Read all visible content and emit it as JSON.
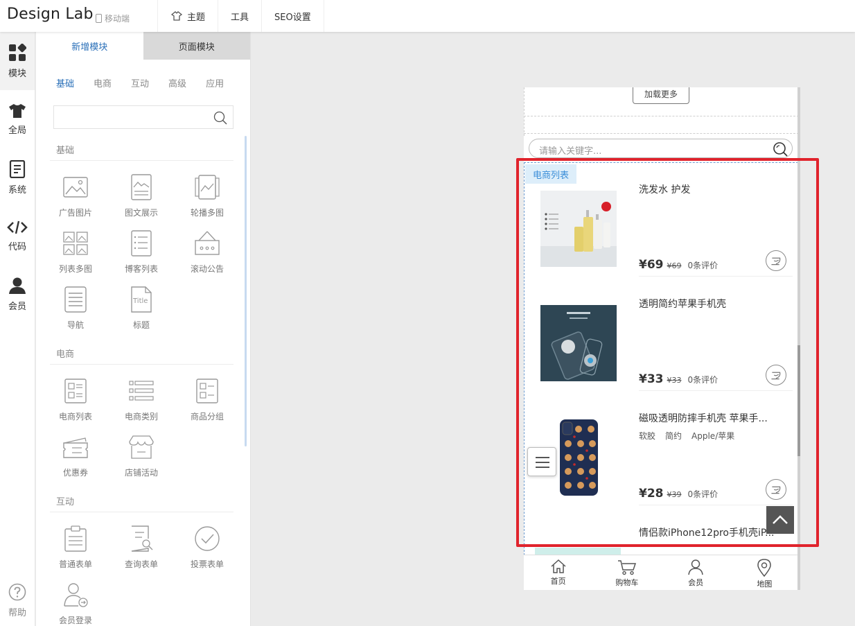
{
  "app": {
    "brand": "Design Lab",
    "device_label": "移动端"
  },
  "topnav": [
    {
      "label": "主题",
      "icon": "theme-icon"
    },
    {
      "label": "工具",
      "icon": ""
    },
    {
      "label": "SEO设置",
      "icon": ""
    }
  ],
  "rail": [
    {
      "label": "模块",
      "icon": "modules-icon",
      "active": true
    },
    {
      "label": "全局",
      "icon": "shirt-icon"
    },
    {
      "label": "系统",
      "icon": "document-icon"
    },
    {
      "label": "代码",
      "icon": "code-icon"
    },
    {
      "label": "会员",
      "icon": "user-icon"
    },
    {
      "label": "帮助",
      "icon": "help-icon"
    }
  ],
  "panel": {
    "tabs": [
      "新增模块",
      "页面模块"
    ],
    "categories": [
      "基础",
      "电商",
      "互动",
      "高级",
      "应用"
    ],
    "sections": {
      "basic": {
        "title": "基础",
        "items": [
          "广告图片",
          "图文展示",
          "轮播多图",
          "列表多图",
          "博客列表",
          "滚动公告",
          "导航",
          "标题"
        ]
      },
      "ecommerce": {
        "title": "电商",
        "items": [
          "电商列表",
          "电商类别",
          "商品分组",
          "优惠券",
          "店铺活动"
        ]
      },
      "interact": {
        "title": "互动",
        "items": [
          "普通表单",
          "查询表单",
          "投票表单",
          "会员登录"
        ]
      }
    },
    "title_icon_text": "Title"
  },
  "preview": {
    "load_more": "加载更多",
    "search_placeholder": "请输入关键字...",
    "ecom_tag": "电商列表",
    "products": [
      {
        "name": "洗发水 护发",
        "price": "¥69",
        "old_price": "¥69",
        "reviews": "0条评价",
        "tags": []
      },
      {
        "name": "透明简约苹果手机壳",
        "price": "¥33",
        "old_price": "¥33",
        "reviews": "0条评价",
        "tags": []
      },
      {
        "name": "磁吸透明防摔手机壳 苹果手...",
        "price": "¥28",
        "old_price": "¥39",
        "reviews": "0条评价",
        "tags": [
          "软胶",
          "简约",
          "Apple/苹果"
        ]
      },
      {
        "name": "情侣款iPhone12pro手机壳iP...",
        "price": "",
        "old_price": "",
        "reviews": "",
        "tags": []
      }
    ],
    "bottom_nav": [
      "首页",
      "购物车",
      "会员",
      "地图"
    ]
  },
  "colors": {
    "accent": "#2a6fb8",
    "highlight_box": "#e0232c",
    "ecom_tag_bg": "#ddeefa"
  }
}
